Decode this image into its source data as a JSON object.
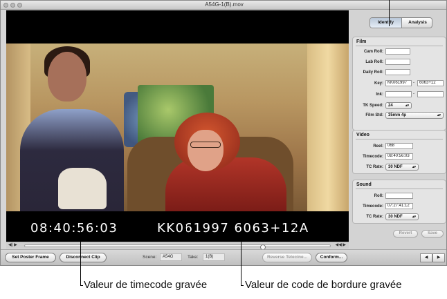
{
  "window": {
    "title": "A54G-1(B).mov"
  },
  "overlay": {
    "timecode": "08:40:56:03",
    "keycode": "KK061997 6063+12A"
  },
  "tabs": [
    {
      "label": "Identify"
    },
    {
      "label": "Analysis"
    }
  ],
  "film": {
    "title": "Film",
    "cam_roll_label": "Cam Roll:",
    "cam_roll": "",
    "lab_roll_label": "Lab Roll:",
    "lab_roll": "",
    "daily_roll_label": "Daily Roll:",
    "daily_roll": "",
    "key_label": "Key:",
    "key_prefix": "KK061997",
    "key_sep": "-",
    "key_value": "6063+12",
    "ink_label": "Ink:",
    "ink_a": "",
    "ink_sep": "-",
    "ink_b": "",
    "tk_speed_label": "TK Speed:",
    "tk_speed": "24",
    "film_std_label": "Film Std:",
    "film_std": "35mm 4p"
  },
  "video": {
    "title": "Video",
    "reel_label": "Reel:",
    "reel": "068",
    "timecode_label": "Timecode:",
    "timecode": "08:40:56:03",
    "tc_rate_label": "TC Rate:",
    "tc_rate": "30 NDF"
  },
  "sound": {
    "title": "Sound",
    "roll_label": "Roll:",
    "roll": "",
    "timecode_label": "Timecode:",
    "timecode": "07:27:41:12",
    "tc_rate_label": "TC Rate:",
    "tc_rate": "30 NDF"
  },
  "side_buttons": {
    "revert": "Revert",
    "save": "Save"
  },
  "toolbar": {
    "set_poster_frame": "Set Poster Frame",
    "disconnect_clip": "Disconnect Clip",
    "scene_label": "Scene:",
    "scene": "A54G",
    "take_label": "Take:",
    "take": "1(B)",
    "reverse_telecine": "Reverse Telecine...",
    "conform": "Conform..."
  },
  "captions": {
    "burned_timecode": "Valeur de timecode gravée",
    "burned_keycode": "Valeur de code de bordure gravée"
  }
}
